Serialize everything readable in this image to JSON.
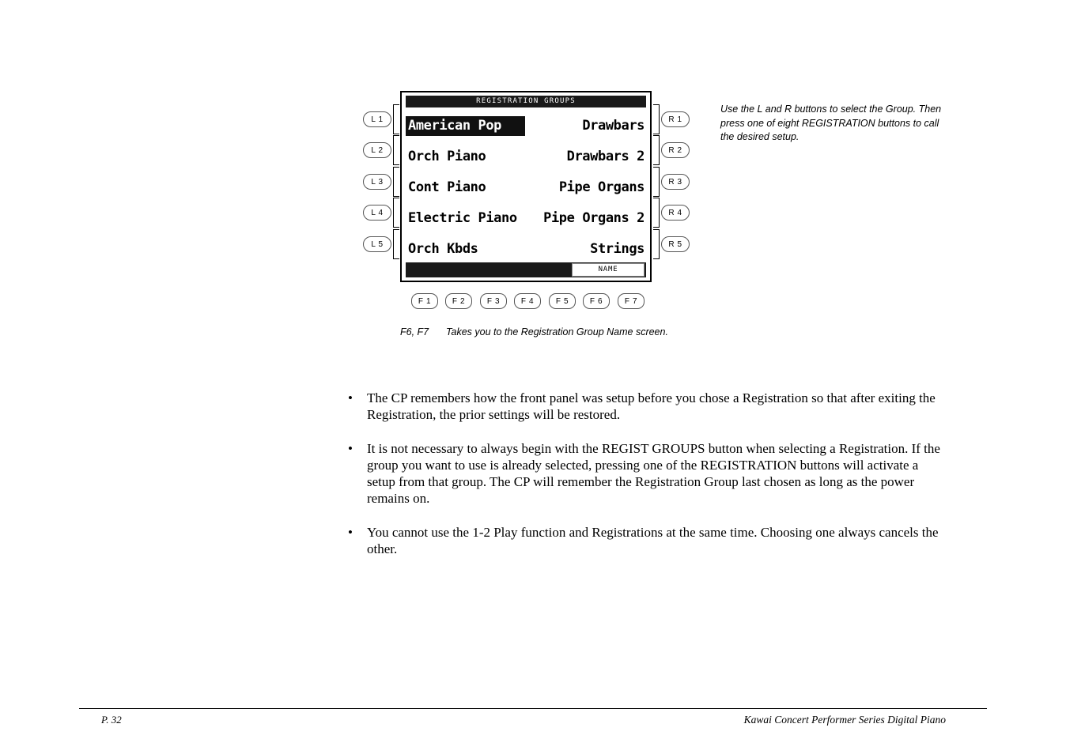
{
  "lcd": {
    "title": "REGISTRATION GROUPS",
    "rows": [
      {
        "left": "American Pop",
        "right": "Drawbars",
        "selected": true
      },
      {
        "left": "Orch Piano",
        "right": "Drawbars 2",
        "selected": false
      },
      {
        "left": "Cont Piano",
        "right": "Pipe Organs",
        "selected": false
      },
      {
        "left": "Electric Piano",
        "right": "Pipe Organs 2",
        "selected": false
      },
      {
        "left": "Orch Kbds",
        "right": "Strings",
        "selected": false
      }
    ],
    "name_button": "NAME"
  },
  "left_buttons": [
    {
      "label": "L 1"
    },
    {
      "label": "L 2"
    },
    {
      "label": "L 3"
    },
    {
      "label": "L 4"
    },
    {
      "label": "L 5"
    }
  ],
  "right_buttons": [
    {
      "label": "R 1"
    },
    {
      "label": "R 2"
    },
    {
      "label": "R 3"
    },
    {
      "label": "R 4"
    },
    {
      "label": "R 5"
    }
  ],
  "function_buttons": [
    {
      "label": "F 1"
    },
    {
      "label": "F 2"
    },
    {
      "label": "F 3"
    },
    {
      "label": "F 4"
    },
    {
      "label": "F 5"
    },
    {
      "label": "F 6"
    },
    {
      "label": "F 7"
    }
  ],
  "annotation": "Use the L and R buttons to select the Group. Then press one of eight REGISTRATION buttons to call the desired setup.",
  "caption": {
    "keys": "F6, F7",
    "text": "Takes you to the Registration Group Name screen."
  },
  "bullets": [
    {
      "marker": "•",
      "text": "The CP remembers how the front panel was setup before you chose a Registration so that after exiting the Registration, the prior settings will be restored."
    },
    {
      "marker": "•",
      "text": "It is not necessary to always begin with the REGIST GROUPS button when selecting a Registration.  If the group you want to use is already selected, pressing one of the REGISTRATION buttons will activate a setup from that group.  The CP will remember the Registration Group last chosen as long as the power remains on."
    },
    {
      "marker": "•",
      "text": "You cannot use the 1-2 Play function and Registrations at the same time.  Choosing one always cancels the other."
    }
  ],
  "footer": {
    "page": "P. 32",
    "product": "Kawai Concert Performer Series Digital Piano"
  }
}
